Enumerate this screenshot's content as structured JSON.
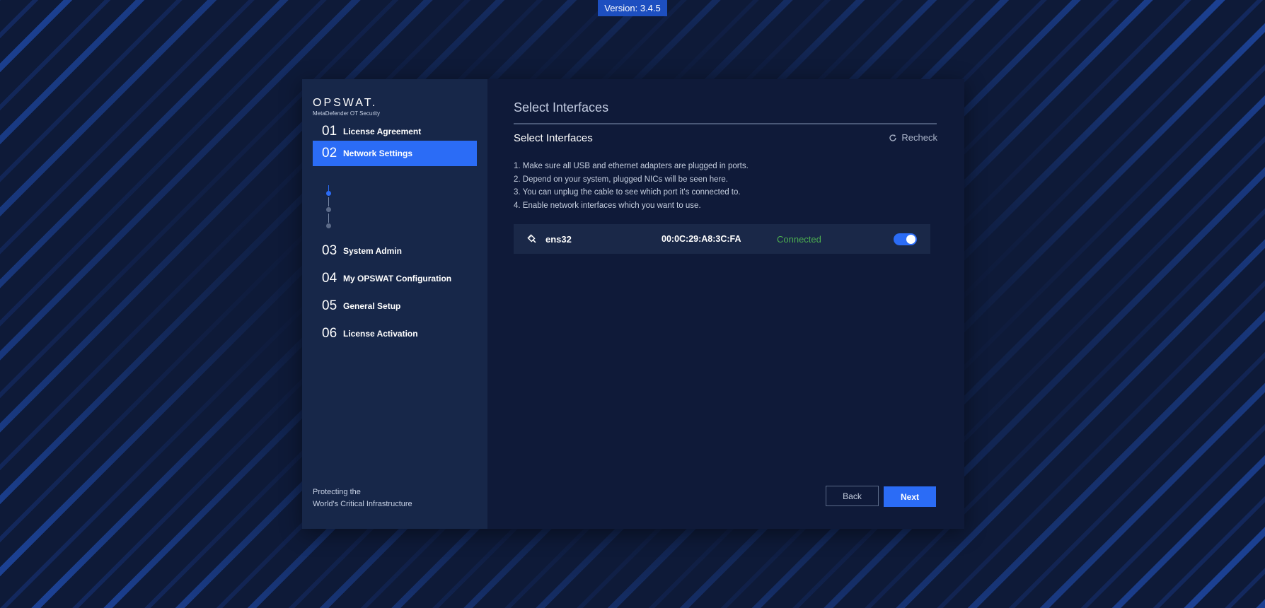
{
  "version": "Version: 3.4.5",
  "brand": {
    "logo": "OPSWAT.",
    "product": "MetaDefender OT Security",
    "tagline_line1": "Protecting the",
    "tagline_line2": "World's Critical Infrastructure"
  },
  "steps": [
    {
      "num": "01",
      "label": "License Agreement"
    },
    {
      "num": "02",
      "label": "Network Settings"
    },
    {
      "num": "03",
      "label": "System Admin"
    },
    {
      "num": "04",
      "label": "My OPSWAT Configuration"
    },
    {
      "num": "05",
      "label": "General Setup"
    },
    {
      "num": "06",
      "label": "License Activation"
    }
  ],
  "active_step": "02",
  "main": {
    "page_title": "Select Interfaces",
    "section_title": "Select Interfaces",
    "recheck_label": "Recheck",
    "instructions": [
      "1. Make sure all USB and ethernet adapters are plugged in ports.",
      "2. Depend on your system, plugged NICs will be seen here.",
      "3. You can unplug the cable to see which port it's connected to.",
      "4. Enable network interfaces which you want to use."
    ],
    "interfaces": [
      {
        "name": "ens32",
        "mac": "00:0C:29:A8:3C:FA",
        "status": "Connected",
        "enabled": true
      }
    ],
    "back_label": "Back",
    "next_label": "Next"
  },
  "colors": {
    "accent": "#2b6cf6",
    "status_connected": "#4caf50",
    "sidebar_bg": "#172749",
    "main_bg": "#0f1a39"
  },
  "icons": {
    "recheck": "refresh-icon",
    "interface": "ethernet-plug-icon"
  }
}
